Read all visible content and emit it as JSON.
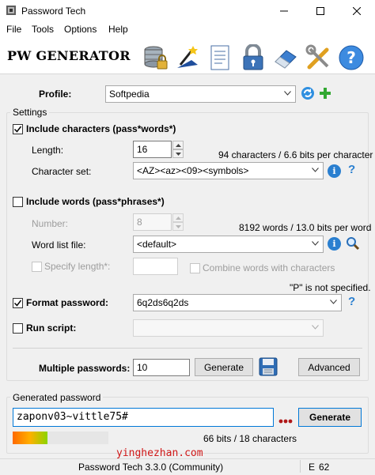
{
  "window": {
    "title": "Password Tech"
  },
  "menu": [
    "File",
    "Tools",
    "Options",
    "Help"
  ],
  "toolbar": {
    "app_title": "PW GENERATOR"
  },
  "profile": {
    "label": "Profile:",
    "value": "Softpedia"
  },
  "settings": {
    "title": "Settings",
    "include_characters": {
      "label": "Include characters (pass*words*)",
      "checked": true
    },
    "length": {
      "label": "Length:",
      "value": "16"
    },
    "char_info": "94 characters / 6.6 bits per character",
    "character_set": {
      "label": "Character set:",
      "value": "<AZ><az><09><symbols>"
    },
    "include_words": {
      "label": "Include words (pass*phrases*)",
      "checked": false
    },
    "number": {
      "label": "Number:",
      "value": "8"
    },
    "word_info": "8192 words / 13.0 bits per word",
    "word_list_file": {
      "label": "Word list file:",
      "value": "<default>"
    },
    "specify_length": {
      "label": "Specify length*:",
      "checked": false
    },
    "combine_words": {
      "label": "Combine words with characters",
      "checked": false
    },
    "p_note": "\"P\" is not specified.",
    "format_password": {
      "label": "Format password:",
      "value": "6q2ds6q2ds",
      "checked": true
    },
    "run_script": {
      "label": "Run script:",
      "value": "",
      "checked": false
    },
    "multiple_passwords": {
      "label": "Multiple passwords:",
      "value": "10"
    },
    "generate_label": "Generate",
    "advanced_label": "Advanced"
  },
  "generated": {
    "title": "Generated password",
    "password": "zaponv03~vittle75#",
    "generate_label": "Generate",
    "strength_info": "66 bits / 18 characters",
    "strength_fraction": 0.36
  },
  "status": {
    "version": "Password Tech 3.3.0 (Community)",
    "lang": "E",
    "count": "62"
  },
  "watermark": "yinghezhan.com"
}
